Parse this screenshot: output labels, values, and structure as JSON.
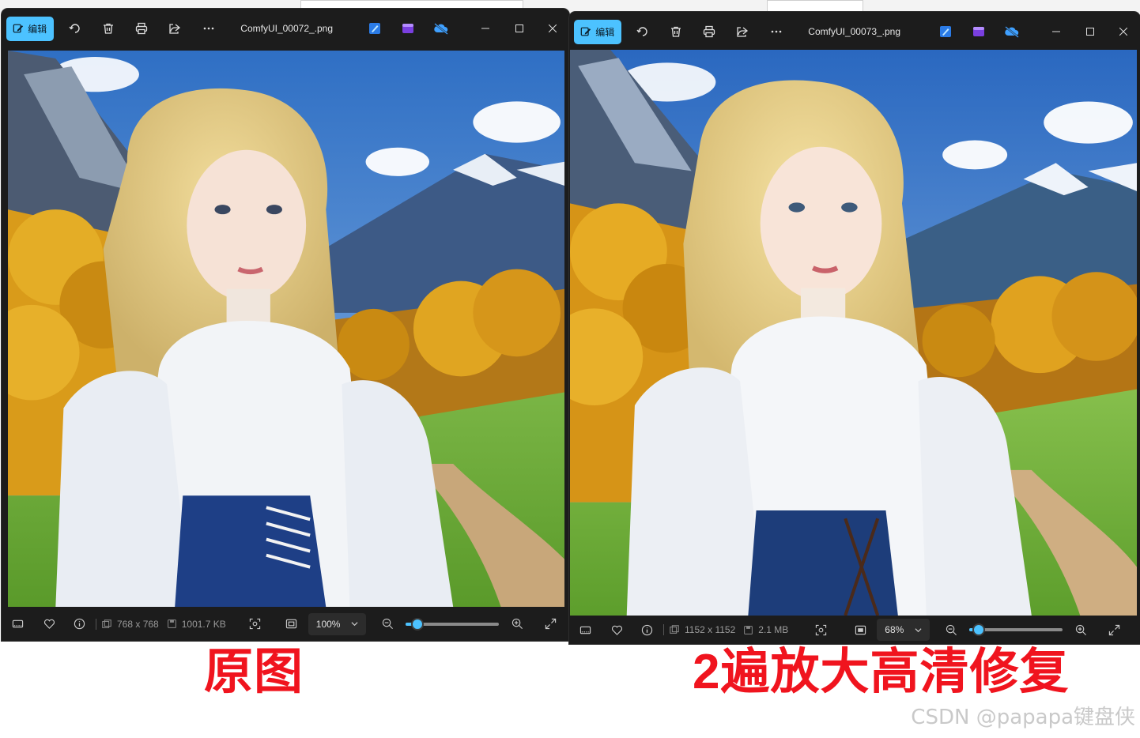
{
  "left_window": {
    "edit_label": "编辑",
    "filename": "ComfyUI_00072_.png",
    "dimensions": "768 x 768",
    "file_size": "1001.7 KB",
    "zoom": "100%",
    "zoom_level": 0.12
  },
  "right_window": {
    "edit_label": "编辑",
    "filename": "ComfyUI_00073_.png",
    "dimensions": "1152 x 1152",
    "file_size": "2.1 MB",
    "zoom": "68%",
    "zoom_level": 0.1
  },
  "captions": {
    "left": "原图",
    "right": "2遍放大高清修复"
  },
  "watermark": "CSDN @papapa键盘侠",
  "colors": {
    "accent": "#4cc2ff",
    "caption_red": "#f0141e",
    "window_bg": "#1c1c1c"
  }
}
